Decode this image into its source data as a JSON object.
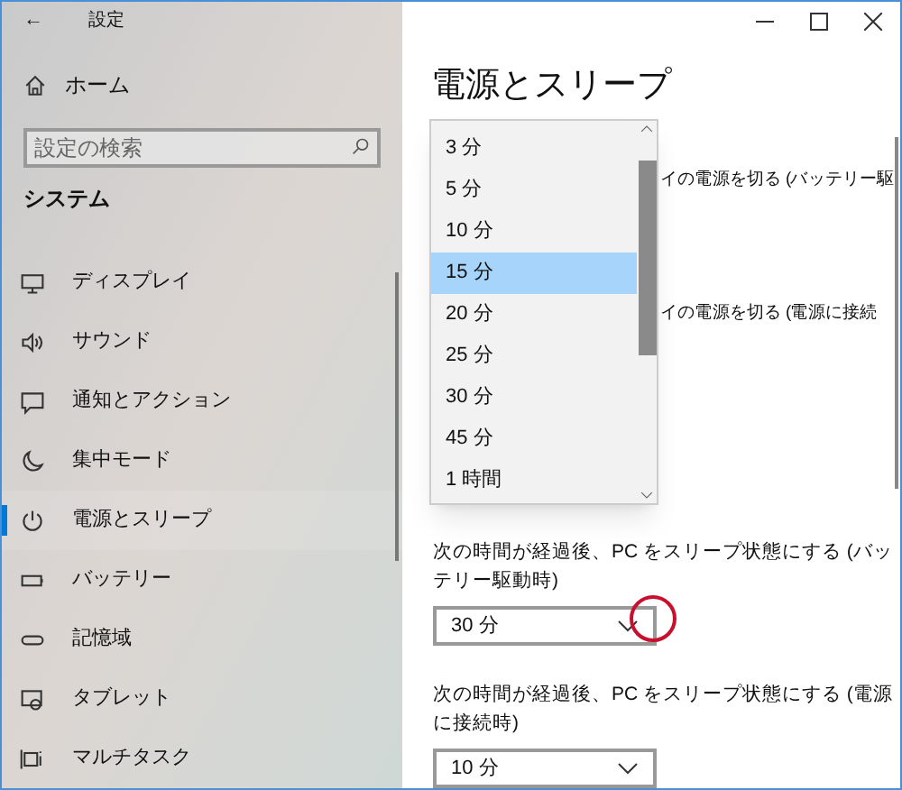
{
  "window": {
    "title": "設定",
    "back": "←"
  },
  "sidebar": {
    "home": "ホーム",
    "search": {
      "placeholder": "設定の検索"
    },
    "section": "システム",
    "items": [
      {
        "label": "ディスプレイ",
        "kind": "display",
        "selected": false
      },
      {
        "label": "サウンド",
        "kind": "sound",
        "selected": false
      },
      {
        "label": "通知とアクション",
        "kind": "notify",
        "selected": false
      },
      {
        "label": "集中モード",
        "kind": "moon",
        "selected": false
      },
      {
        "label": "電源とスリープ",
        "kind": "power",
        "selected": true
      },
      {
        "label": "バッテリー",
        "kind": "battery",
        "selected": false
      },
      {
        "label": "記憶域",
        "kind": "storage",
        "selected": false
      },
      {
        "label": "タブレット",
        "kind": "tablet",
        "selected": false
      },
      {
        "label": "マルチタスク",
        "kind": "multitask",
        "selected": false
      }
    ]
  },
  "page": {
    "title": "電源とスリープ",
    "screen_labels": [
      "イの電源を切る (バッテリー駆",
      "イの電源を切る (電源に接続"
    ],
    "sleep": [
      {
        "label": "次の時間が経過後、PC をスリープ状態にする (バッテリー駆動時)",
        "value": "30 分",
        "highlighted": true
      },
      {
        "label": "次の時間が経過後、PC をスリープ状態にする (電源に接続時)",
        "value": "10 分",
        "highlighted": false
      }
    ]
  },
  "dropdown": {
    "options": [
      {
        "label": "3 分",
        "selected": false
      },
      {
        "label": "5 分",
        "selected": false
      },
      {
        "label": "10 分",
        "selected": false
      },
      {
        "label": "15 分",
        "selected": true
      },
      {
        "label": "20 分",
        "selected": false
      },
      {
        "label": "25 分",
        "selected": false
      },
      {
        "label": "30 分",
        "selected": false
      },
      {
        "label": "45 分",
        "selected": false
      },
      {
        "label": "1 時間",
        "selected": false
      }
    ]
  }
}
